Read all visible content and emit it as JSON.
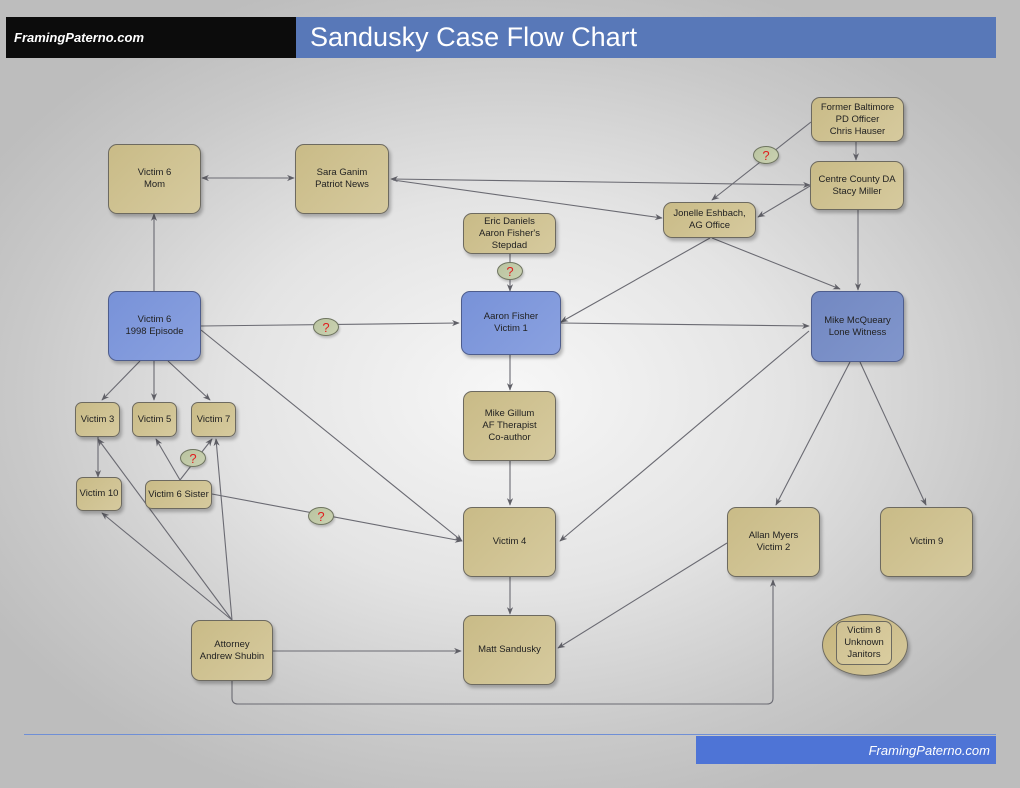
{
  "header": {
    "site_label": "FramingPaterno.com",
    "title": "Sandusky Case Flow Chart"
  },
  "footer": {
    "site_label": "FramingPaterno.com"
  },
  "colors": {
    "header_left_bg": "#0c0c0c",
    "header_right_bg": "#5878b8",
    "footer_bg": "#4e74d6",
    "node_tan": "#cfc291",
    "node_blue": "#7f97dc",
    "node_steel": "#7a8ec6",
    "question_mark": "#e02020",
    "connector": "#5f5f66"
  },
  "question_marker_text": "?",
  "nodes": {
    "hauser": "Former Baltimore\nPD Officer\nChris Hauser",
    "miller": "Centre County DA\nStacy Miller",
    "v6mom": "Victim 6\nMom",
    "ganim": "Sara Ganim\nPatriot News",
    "eshbach": "Jonelle Eshbach,\nAG Office",
    "daniels": "Eric Daniels\nAaron Fisher's\nStepdad",
    "v6": "Victim 6\n1998 Episode",
    "fisher": "Aaron Fisher\nVictim 1",
    "mcqueary": "Mike McQueary\nLone Witness",
    "v3": "Victim 3",
    "v5": "Victim 5",
    "v7": "Victim 7",
    "gillum": "Mike Gillum\nAF Therapist\nCo-author",
    "v10": "Victim 10",
    "v6sister": "Victim 6 Sister",
    "v4": "Victim 4",
    "myers": "Allan Myers\nVictim 2",
    "v9": "Victim 9",
    "v8": "Victim 8\nUnknown\nJanitors",
    "shubin": "Attorney\nAndrew Shubin",
    "matt": "Matt Sandusky"
  },
  "edges": [
    {
      "from": "hauser",
      "to": "miller",
      "type": "arrow"
    },
    {
      "from": "hauser",
      "to": "eshbach",
      "type": "arrow",
      "uncertain": true
    },
    {
      "from": "miller",
      "to": "eshbach",
      "type": "arrow"
    },
    {
      "from": "miller",
      "to": "mcqueary",
      "type": "arrow"
    },
    {
      "from": "v6mom",
      "to": "ganim",
      "type": "bidirectional"
    },
    {
      "from": "ganim",
      "to": "miller",
      "type": "bidirectional"
    },
    {
      "from": "ganim",
      "to": "eshbach",
      "type": "arrow"
    },
    {
      "from": "eshbach",
      "to": "fisher",
      "type": "arrow"
    },
    {
      "from": "eshbach",
      "to": "mcqueary",
      "type": "arrow"
    },
    {
      "from": "daniels",
      "to": "fisher",
      "type": "arrow",
      "uncertain": true
    },
    {
      "from": "v6",
      "to": "v6mom",
      "type": "arrow"
    },
    {
      "from": "v6",
      "to": "fisher",
      "type": "arrow",
      "uncertain": true
    },
    {
      "from": "v6",
      "to": "v3",
      "type": "arrow"
    },
    {
      "from": "v6",
      "to": "v5",
      "type": "arrow"
    },
    {
      "from": "v6",
      "to": "v7",
      "type": "arrow"
    },
    {
      "from": "v6",
      "to": "v4",
      "type": "arrow"
    },
    {
      "from": "fisher",
      "to": "mcqueary",
      "type": "arrow"
    },
    {
      "from": "fisher",
      "to": "gillum",
      "type": "arrow"
    },
    {
      "from": "gillum",
      "to": "v4",
      "type": "arrow"
    },
    {
      "from": "mcqueary",
      "to": "v4",
      "type": "arrow"
    },
    {
      "from": "mcqueary",
      "to": "myers",
      "type": "arrow"
    },
    {
      "from": "mcqueary",
      "to": "v9",
      "type": "arrow"
    },
    {
      "from": "v3",
      "to": "v10",
      "type": "arrow"
    },
    {
      "from": "v6sister",
      "to": "v5",
      "type": "arrow"
    },
    {
      "from": "v6sister",
      "to": "v7",
      "type": "arrow",
      "uncertain": true
    },
    {
      "from": "v6sister",
      "to": "v4",
      "type": "arrow",
      "uncertain": true
    },
    {
      "from": "v4",
      "to": "matt",
      "type": "arrow"
    },
    {
      "from": "myers",
      "to": "matt",
      "type": "arrow"
    },
    {
      "from": "shubin",
      "to": "v3",
      "type": "arrow"
    },
    {
      "from": "shubin",
      "to": "v7",
      "type": "arrow"
    },
    {
      "from": "shubin",
      "to": "v10",
      "type": "arrow"
    },
    {
      "from": "shubin",
      "to": "matt",
      "type": "arrow"
    },
    {
      "from": "shubin",
      "to": "myers",
      "type": "arrow"
    }
  ]
}
